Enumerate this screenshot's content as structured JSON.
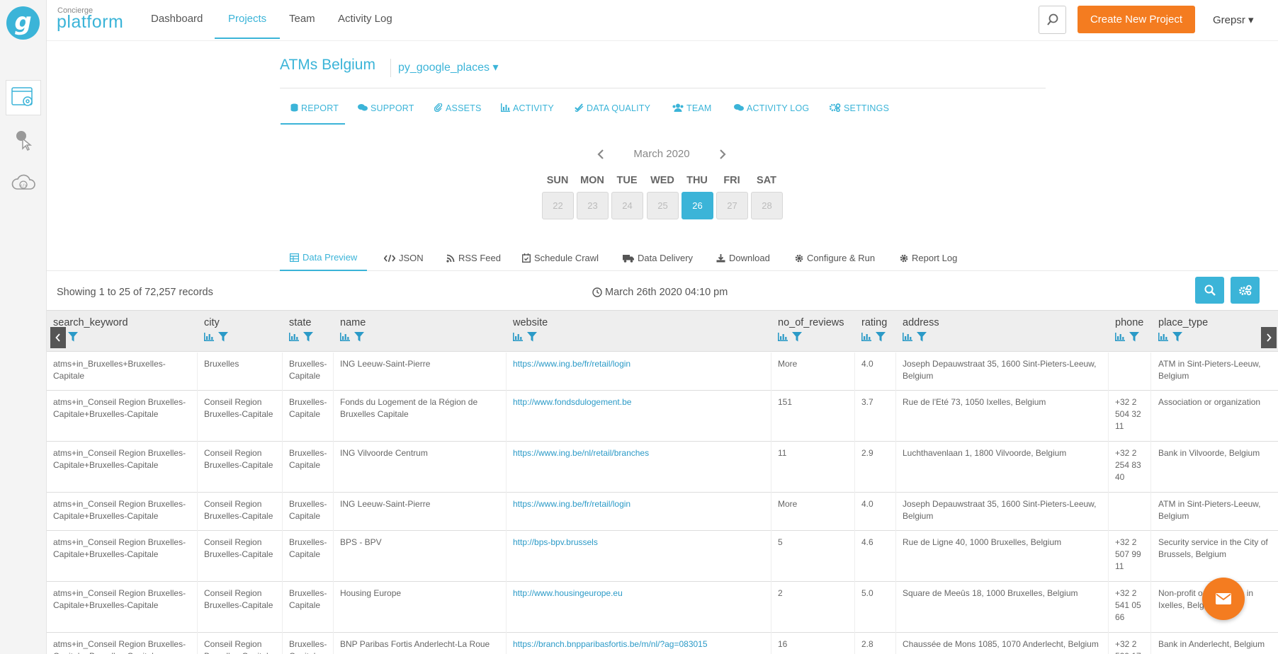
{
  "brand": {
    "small": "Concierge",
    "big": "platform",
    "logo_letter": "g"
  },
  "nav": [
    {
      "label": "Dashboard"
    },
    {
      "label": "Projects"
    },
    {
      "label": "Team"
    },
    {
      "label": "Activity Log"
    }
  ],
  "header": {
    "create_label": "Create New Project",
    "user": "Grepsr ▾"
  },
  "project": {
    "title": "ATMs Belgium",
    "subtitle": "py_google_places ▾"
  },
  "project_tabs": [
    {
      "label": "REPORT"
    },
    {
      "label": "SUPPORT"
    },
    {
      "label": "ASSETS"
    },
    {
      "label": "ACTIVITY"
    },
    {
      "label": "DATA QUALITY"
    },
    {
      "label": "TEAM"
    },
    {
      "label": "ACTIVITY LOG"
    },
    {
      "label": "SETTINGS"
    }
  ],
  "calendar": {
    "month": "March 2020",
    "prev": "‹",
    "next": "›",
    "weekdays": [
      "SUN",
      "MON",
      "TUE",
      "WED",
      "THU",
      "FRI",
      "SAT"
    ],
    "days": [
      "22",
      "23",
      "24",
      "25",
      "26",
      "27",
      "28"
    ],
    "selected": "26"
  },
  "view_tabs": [
    {
      "label": "Data Preview"
    },
    {
      "label": "JSON"
    },
    {
      "label": "RSS Feed"
    },
    {
      "label": "Schedule Crawl"
    },
    {
      "label": "Data Delivery"
    },
    {
      "label": "Download"
    },
    {
      "label": "Configure & Run"
    },
    {
      "label": "Report Log"
    }
  ],
  "records": {
    "showing": "Showing 1 to 25 of 72,257 records",
    "timestamp": "March 26th 2020 04:10 pm"
  },
  "columns": [
    "search_keyword",
    "city",
    "state",
    "name",
    "website",
    "no_of_reviews",
    "rating",
    "address",
    "phone",
    "place_type"
  ],
  "rows": [
    [
      "atms+in_Bruxelles+Bruxelles-Capitale",
      "Bruxelles",
      "Bruxelles-Capitale",
      "ING Leeuw-Saint-Pierre",
      "https://www.ing.be/fr/retail/login",
      "More",
      "4.0",
      "Joseph Depauwstraat 35, 1600 Sint-Pieters-Leeuw, Belgium",
      "",
      "ATM in Sint-Pieters-Leeuw, Belgium"
    ],
    [
      "atms+in_Conseil Region Bruxelles-Capitale+Bruxelles-Capitale",
      "Conseil Region Bruxelles-Capitale",
      "Bruxelles-Capitale",
      "Fonds du Logement de la Région de Bruxelles Capitale",
      "http://www.fondsdulogement.be",
      "151",
      "3.7",
      "Rue de l'Eté 73, 1050 Ixelles, Belgium",
      "+32 2 504 32 11",
      "Association or organization"
    ],
    [
      "atms+in_Conseil Region Bruxelles-Capitale+Bruxelles-Capitale",
      "Conseil Region Bruxelles-Capitale",
      "Bruxelles-Capitale",
      "ING Vilvoorde Centrum",
      "https://www.ing.be/nl/retail/branches",
      "11",
      "2.9",
      "Luchthavenlaan 1, 1800 Vilvoorde, Belgium",
      "+32 2 254 83 40",
      "Bank in Vilvoorde, Belgium"
    ],
    [
      "atms+in_Conseil Region Bruxelles-Capitale+Bruxelles-Capitale",
      "Conseil Region Bruxelles-Capitale",
      "Bruxelles-Capitale",
      "ING Leeuw-Saint-Pierre",
      "https://www.ing.be/fr/retail/login",
      "More",
      "4.0",
      "Joseph Depauwstraat 35, 1600 Sint-Pieters-Leeuw, Belgium",
      "",
      "ATM in Sint-Pieters-Leeuw, Belgium"
    ],
    [
      "atms+in_Conseil Region Bruxelles-Capitale+Bruxelles-Capitale",
      "Conseil Region Bruxelles-Capitale",
      "Bruxelles-Capitale",
      "BPS - BPV",
      "http://bps-bpv.brussels",
      "5",
      "4.6",
      "Rue de Ligne 40, 1000 Bruxelles, Belgium",
      "+32 2 507 99 11",
      "Security service in the City of Brussels, Belgium"
    ],
    [
      "atms+in_Conseil Region Bruxelles-Capitale+Bruxelles-Capitale",
      "Conseil Region Bruxelles-Capitale",
      "Bruxelles-Capitale",
      "Housing Europe",
      "http://www.housingeurope.eu",
      "2",
      "5.0",
      "Square de Meeûs 18, 1000 Bruxelles, Belgium",
      "+32 2 541 05 66",
      "Non-profit organization in Ixelles, Belgium"
    ],
    [
      "atms+in_Conseil Region Bruxelles-Capitale+Bruxelles-Capitale",
      "Conseil Region Bruxelles-Capitale",
      "Bruxelles-Capitale",
      "BNP Paribas Fortis Anderlecht-La Roue",
      "https://branch.bnpparibasfortis.be/m/nl/?ag=083015",
      "16",
      "2.8",
      "Chaussée de Mons 1085, 1070 Anderlecht, Belgium",
      "+32 2 529 17",
      "Bank in Anderlecht, Belgium"
    ]
  ],
  "colors": {
    "accent": "#3bb4d8",
    "orange": "#f47c20",
    "link": "#2b9ac7"
  }
}
